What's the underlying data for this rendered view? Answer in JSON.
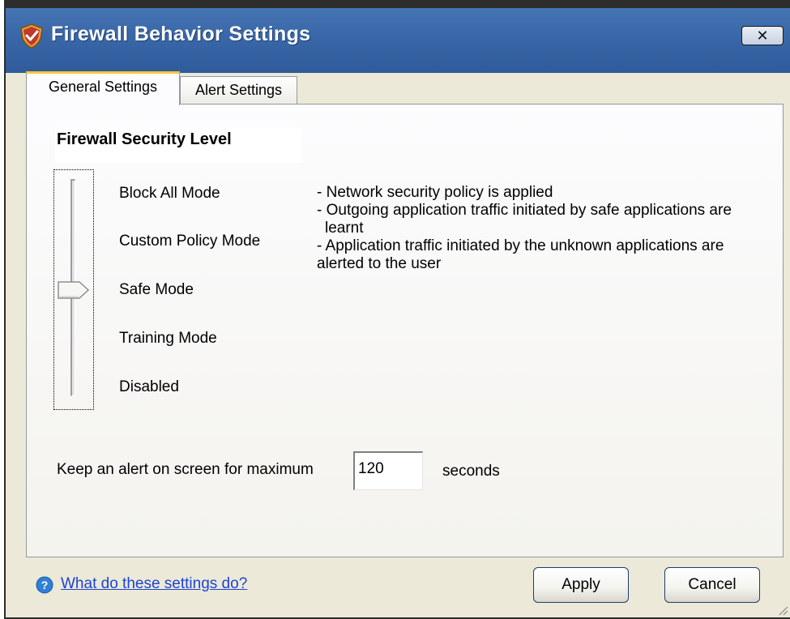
{
  "window": {
    "title": "Firewall Behavior Settings",
    "close_label": "✕"
  },
  "tabs": [
    {
      "label": "General Settings",
      "active": true
    },
    {
      "label": "Alert Settings",
      "active": false
    }
  ],
  "security": {
    "section_title": "Firewall Security Level",
    "modes": [
      "Block All Mode",
      "Custom Policy Mode",
      "Safe Mode",
      "Training Mode",
      "Disabled"
    ],
    "selected_mode": "Safe Mode",
    "description": [
      "- Network security policy is applied",
      "- Outgoing application traffic initiated by safe applications are",
      "learnt",
      "- Application traffic initiated by the unknown applications are",
      "alerted to the user"
    ]
  },
  "alert": {
    "label": "Keep an alert on screen for maximum",
    "value": "120",
    "unit": "seconds"
  },
  "footer": {
    "help_text": "What do these settings do?",
    "apply_label": "Apply",
    "cancel_label": "Cancel"
  },
  "colors": {
    "titlebar": "#3a68a9",
    "window_bg": "#ece9d8",
    "link": "#1c44d4",
    "tab_accent": "#ffc83c"
  }
}
